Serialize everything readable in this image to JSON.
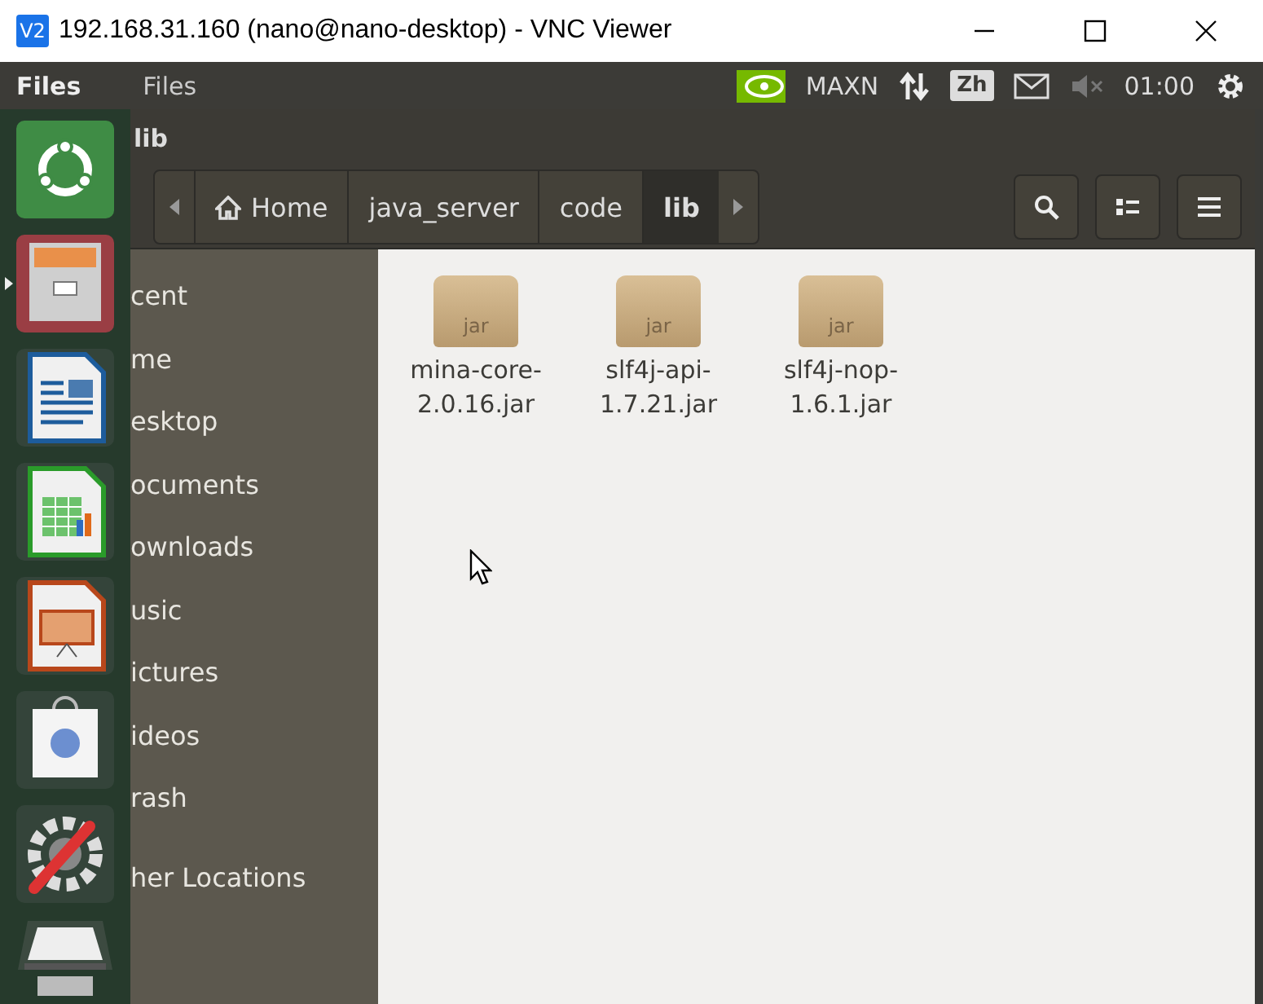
{
  "window": {
    "badge": "V2",
    "title": "192.168.31.160 (nano@nano-desktop) - VNC Viewer"
  },
  "top_panel": {
    "app_name": "Files",
    "menu": "Files",
    "power_mode": "MAXN",
    "input_method": "Zh",
    "time": "01:00"
  },
  "header": {
    "title": "lib"
  },
  "path_bar": {
    "crumbs": [
      {
        "label": "Home",
        "kind": "home",
        "selected": false
      },
      {
        "label": "java_server",
        "kind": "folder",
        "selected": false
      },
      {
        "label": "code",
        "kind": "folder",
        "selected": false
      },
      {
        "label": "lib",
        "kind": "folder",
        "selected": true
      }
    ]
  },
  "launcher": {
    "items": [
      {
        "kind": "ubuntu",
        "running": false
      },
      {
        "kind": "files",
        "running": true
      },
      {
        "kind": "writer",
        "running": false
      },
      {
        "kind": "calc",
        "running": false
      },
      {
        "kind": "impress",
        "running": false
      },
      {
        "kind": "store",
        "running": false
      },
      {
        "kind": "settings",
        "running": false
      },
      {
        "kind": "drive",
        "running": false
      }
    ]
  },
  "sidebar": {
    "items": [
      {
        "label": "cent"
      },
      {
        "label": "me"
      },
      {
        "label": "esktop"
      },
      {
        "label": "ocuments"
      },
      {
        "label": "ownloads"
      },
      {
        "label": "usic"
      },
      {
        "label": "ictures"
      },
      {
        "label": "ideos"
      },
      {
        "label": "rash"
      },
      {
        "label": "her Locations"
      }
    ]
  },
  "files": [
    {
      "icon_label": "jar",
      "name_lines": [
        "mina-core-",
        "2.0.16.jar"
      ]
    },
    {
      "icon_label": "jar",
      "name_lines": [
        "slf4j-api-",
        "1.7.21.jar"
      ]
    },
    {
      "icon_label": "jar",
      "name_lines": [
        "slf4j-nop-",
        "1.6.1.jar"
      ]
    }
  ]
}
